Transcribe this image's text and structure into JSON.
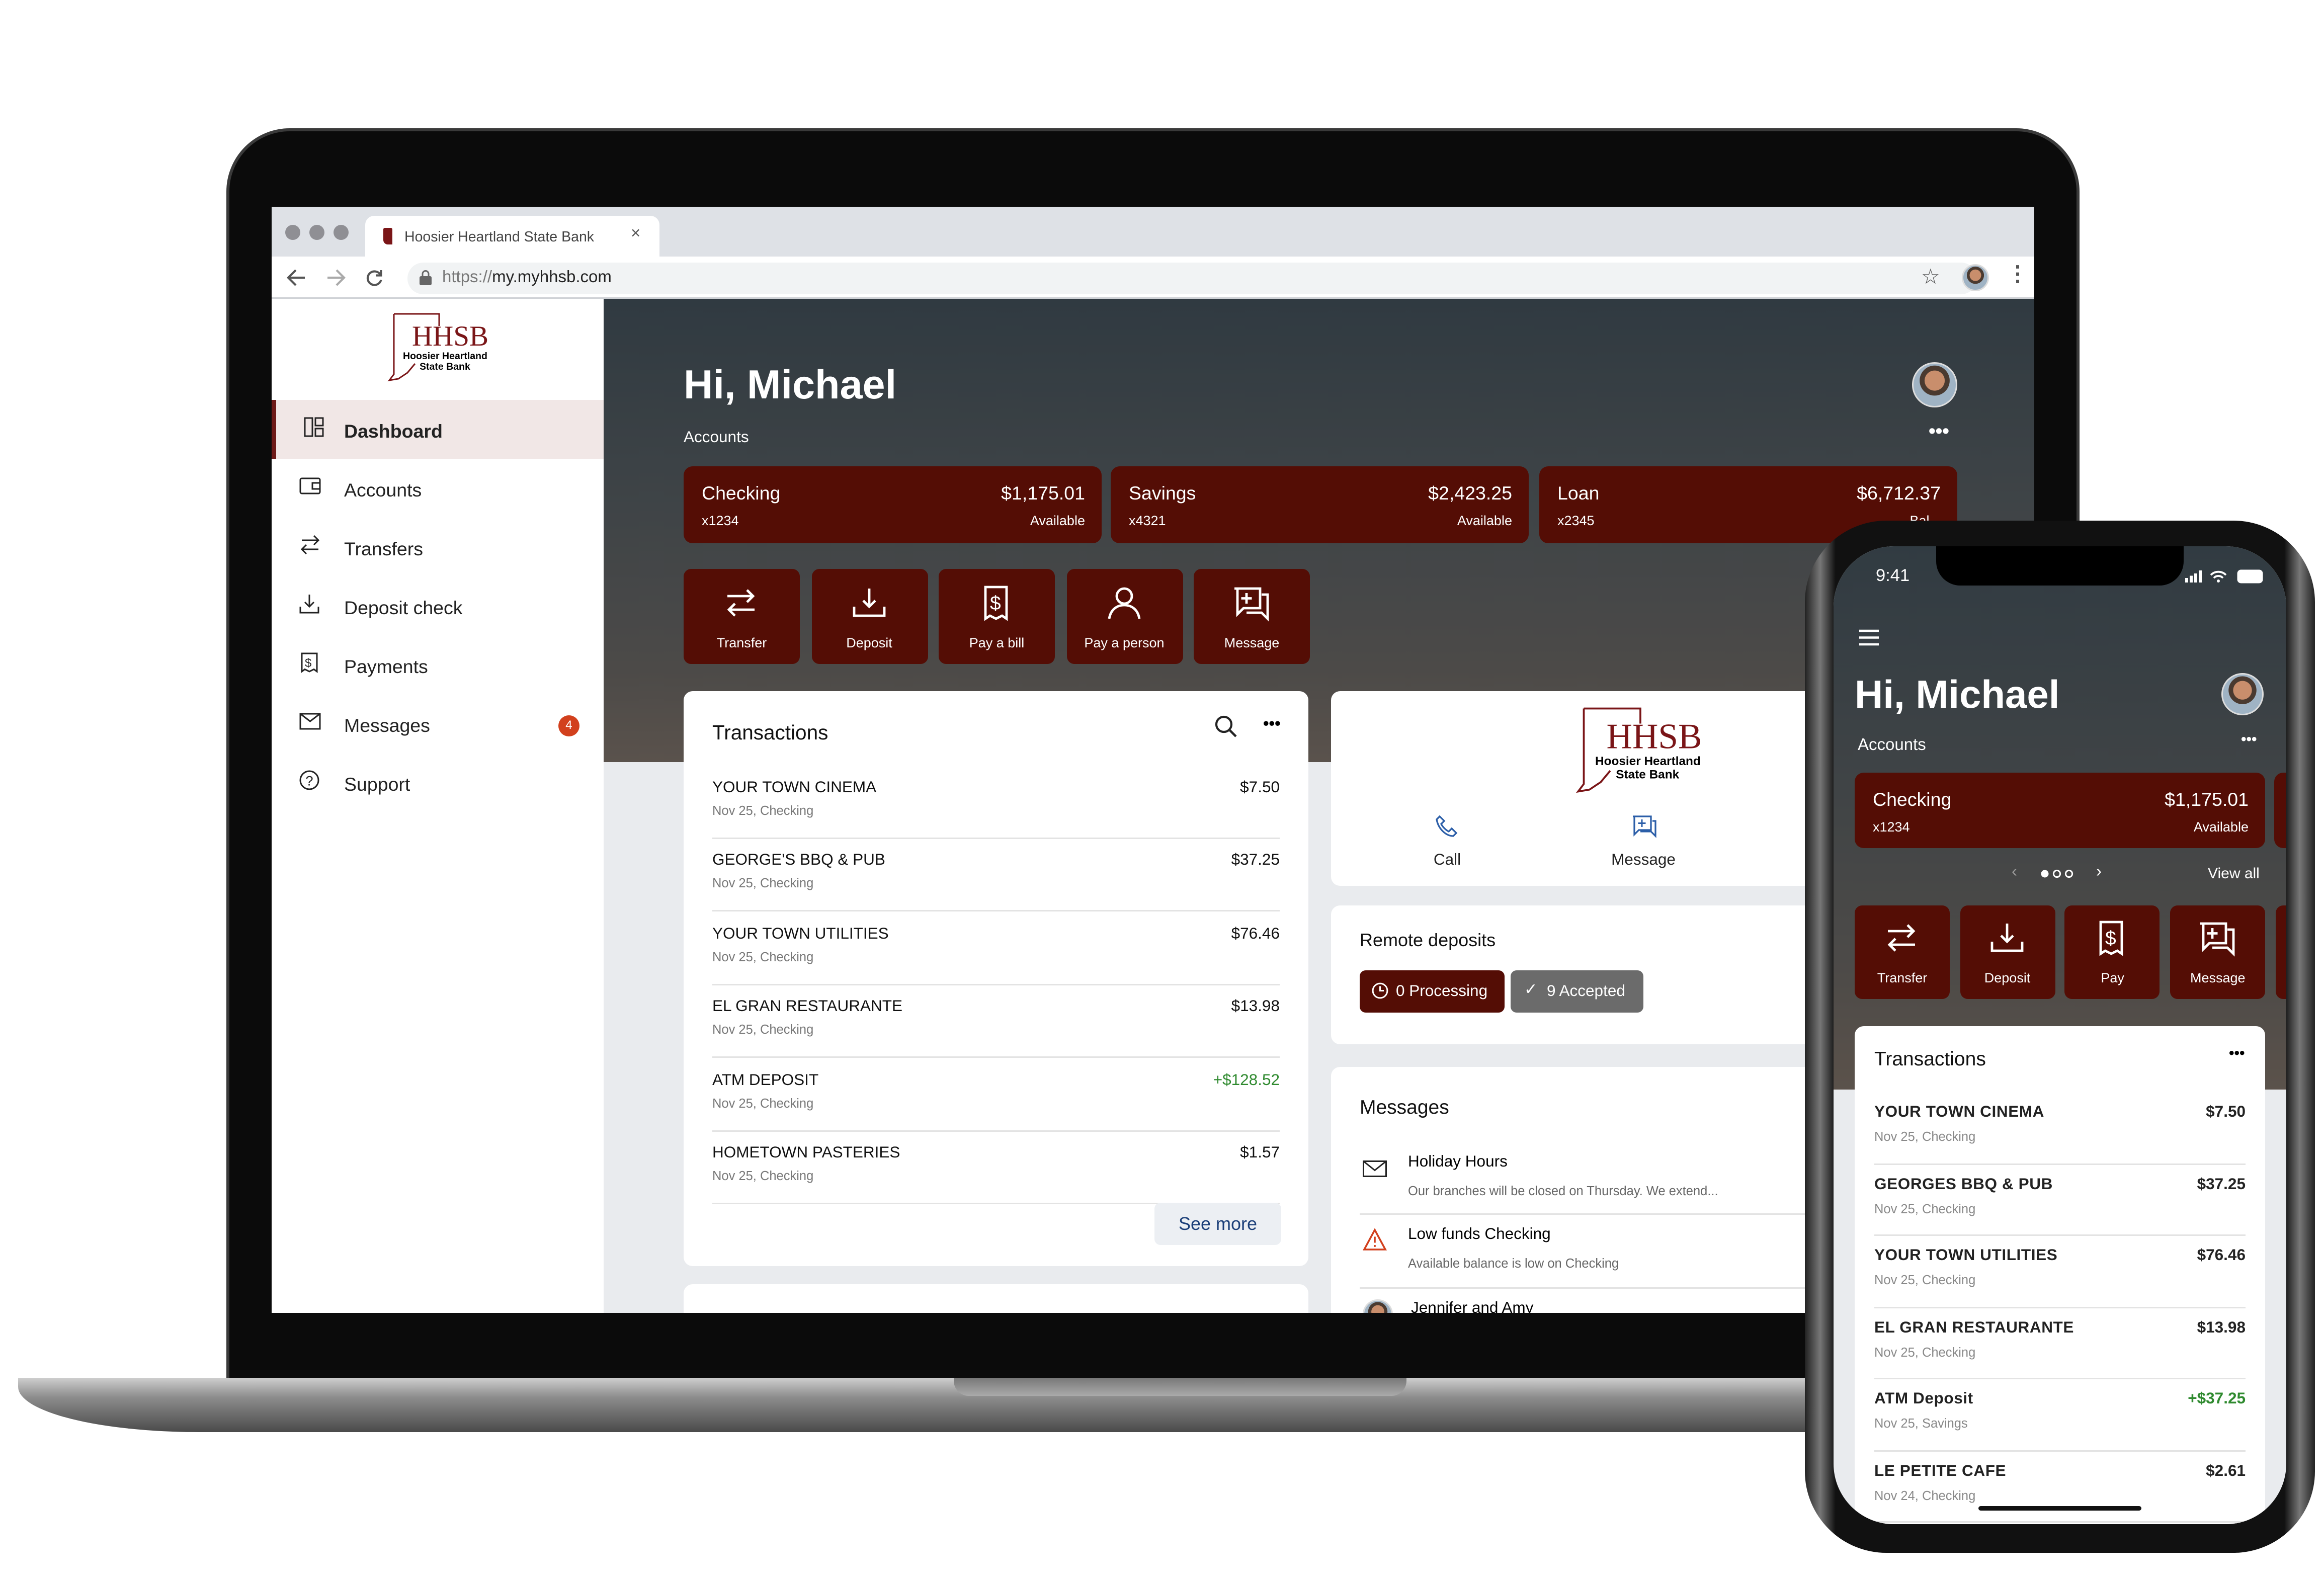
{
  "browser": {
    "tab_title": "Hoosier Heartland State Bank",
    "tab_close": "×",
    "url_scheme": "https://",
    "url_host": "my.myhhsb.com"
  },
  "brand": {
    "logo_letters": "HHSB",
    "logo_name": "Hoosier Heartland State Bank",
    "accent": "#540d05"
  },
  "sidebar": {
    "items": [
      {
        "label": "Dashboard",
        "icon": "dashboard-icon",
        "active": true
      },
      {
        "label": "Accounts",
        "icon": "wallet-icon"
      },
      {
        "label": "Transfers",
        "icon": "transfer-icon"
      },
      {
        "label": "Deposit check",
        "icon": "download-icon"
      },
      {
        "label": "Payments",
        "icon": "bill-icon"
      },
      {
        "label": "Messages",
        "icon": "mail-icon",
        "badge": "4"
      },
      {
        "label": "Support",
        "icon": "help-icon"
      }
    ]
  },
  "main": {
    "greeting": "Hi, Michael",
    "accounts_label": "Accounts",
    "accounts": [
      {
        "name": "Checking",
        "number": "x1234",
        "balance": "$1,175.01",
        "balance_label": "Available"
      },
      {
        "name": "Savings",
        "number": "x4321",
        "balance": "$2,423.25",
        "balance_label": "Available"
      },
      {
        "name": "Loan",
        "number": "x2345",
        "balance": "$6,712.37",
        "balance_label": "Bal..."
      }
    ],
    "actions": [
      "Transfer",
      "Deposit",
      "Pay a bill",
      "Pay a person",
      "Message"
    ],
    "transactions": {
      "title": "Transactions",
      "see_more": "See more",
      "items": [
        {
          "merchant": "YOUR TOWN CINEMA",
          "detail": "Nov 25, Checking",
          "amount": "$7.50"
        },
        {
          "merchant": "GEORGE'S BBQ & PUB",
          "detail": "Nov 25, Checking",
          "amount": "$37.25"
        },
        {
          "merchant": "YOUR TOWN UTILITIES",
          "detail": "Nov 25, Checking",
          "amount": "$76.46"
        },
        {
          "merchant": "EL GRAN RESTAURANTE",
          "detail": "Nov 25, Checking",
          "amount": "$13.98"
        },
        {
          "merchant": "ATM DEPOSIT",
          "detail": "Nov 25, Checking",
          "amount": "+$128.52",
          "credit": true
        },
        {
          "merchant": "HOMETOWN PASTERIES",
          "detail": "Nov 25, Checking",
          "amount": "$1.57"
        }
      ]
    },
    "contact": {
      "call": "Call",
      "message": "Message"
    },
    "remote_deposits": {
      "title": "Remote deposits",
      "processing": "0 Processing",
      "accepted": "9 Accepted"
    },
    "messages": {
      "title": "Messages",
      "items": [
        {
          "title": "Holiday Hours",
          "body": "Our branches will be closed on Thursday. We extend..."
        },
        {
          "title": "Low funds Checking",
          "body": "Available balance is low on Checking"
        },
        {
          "title": "Jennifer and Amy",
          "body": ""
        }
      ]
    }
  },
  "phone": {
    "time": "9:41",
    "greeting": "Hi, Michael",
    "accounts_label": "Accounts",
    "account": {
      "name": "Checking",
      "number": "x1234",
      "balance": "$1,175.01",
      "balance_label": "Available"
    },
    "view_all": "View all",
    "pager": {
      "pages": 3,
      "current": 1
    },
    "actions": [
      "Transfer",
      "Deposit",
      "Pay",
      "Message"
    ],
    "transactions": {
      "title": "Transactions",
      "items": [
        {
          "merchant": "YOUR TOWN CINEMA",
          "detail": "Nov 25, Checking",
          "amount": "$7.50"
        },
        {
          "merchant": "GEORGES BBQ & PUB",
          "detail": "Nov 25, Checking",
          "amount": "$37.25"
        },
        {
          "merchant": "YOUR TOWN UTILITIES",
          "detail": "Nov 25, Checking",
          "amount": "$76.46"
        },
        {
          "merchant": "EL GRAN RESTAURANTE",
          "detail": "Nov 25, Checking",
          "amount": "$13.98"
        },
        {
          "merchant": "ATM Deposit",
          "detail": "Nov 25, Savings",
          "amount": "+$37.25",
          "credit": true
        },
        {
          "merchant": "LE PETITE CAFE",
          "detail": "Nov 24, Checking",
          "amount": "$2.61"
        }
      ]
    }
  }
}
